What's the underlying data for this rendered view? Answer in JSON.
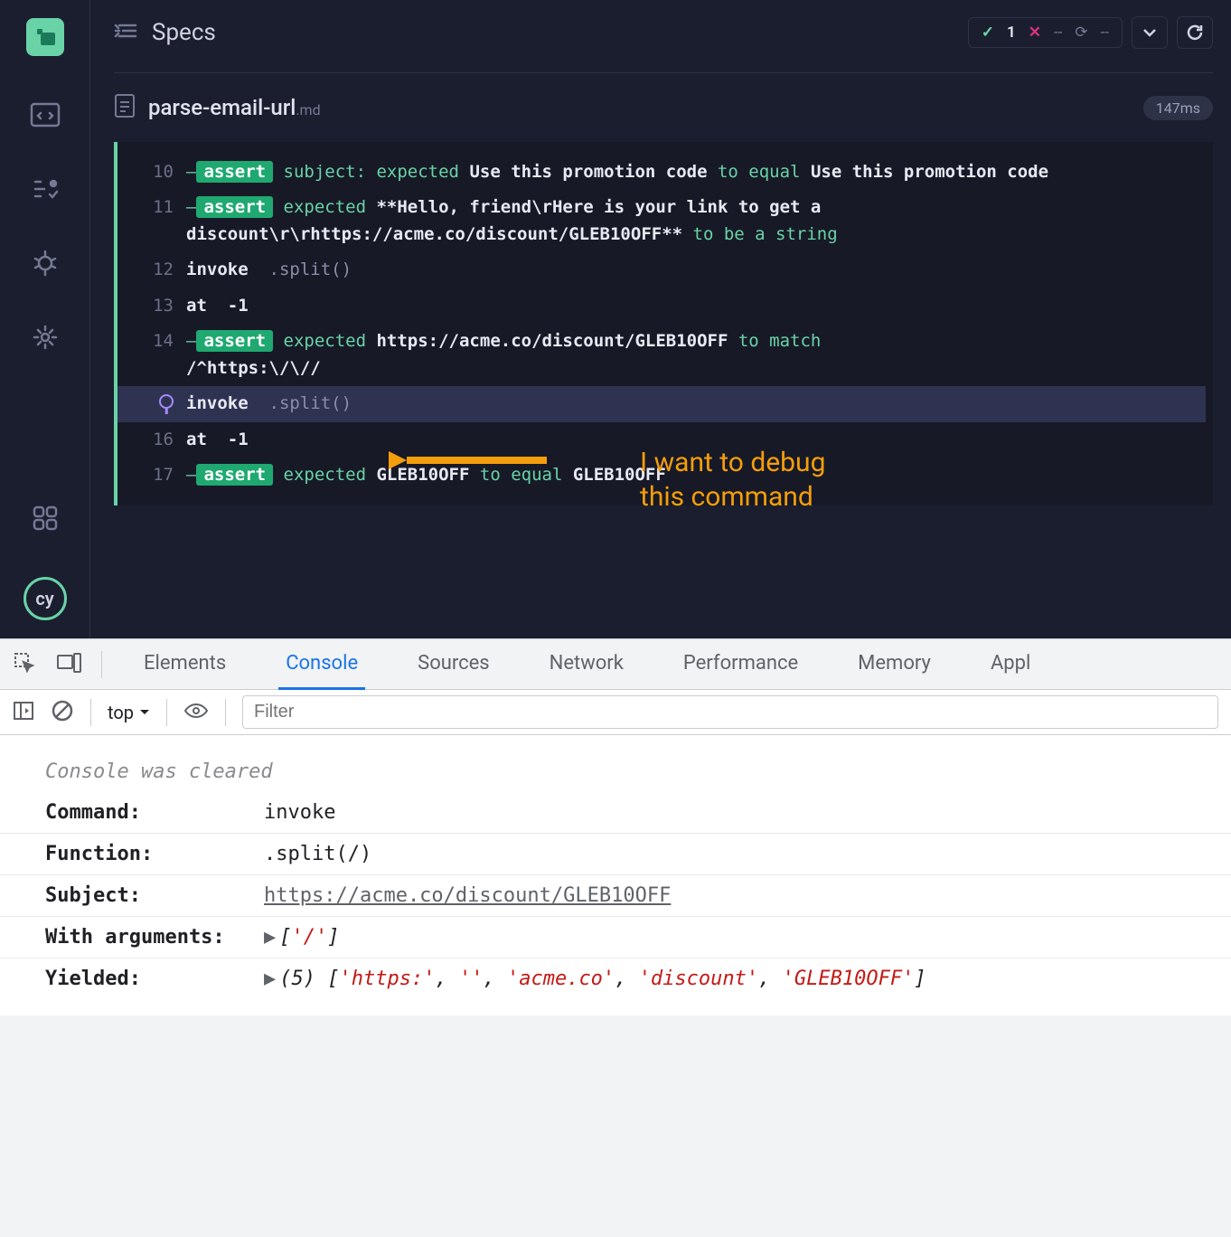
{
  "header": {
    "specs_label": "Specs",
    "pass_count": "1",
    "fail_count": "--",
    "pending_count": "--"
  },
  "file": {
    "name": "parse-email-url",
    "ext": ".md",
    "time": "147ms"
  },
  "log": [
    {
      "n": "10",
      "pre": "—",
      "badge": "assert",
      "a": " subject: expected ",
      "b": "Use this promotion code",
      "c": " to equal ",
      "d": "Use this promotion code"
    },
    {
      "n": "11",
      "pre": "—",
      "badge": "assert",
      "a": " expected ",
      "b": "**Hello, friend\\rHere is your link to get a discount\\r\\rhttps://acme.co/discount/GLEB10OFF**",
      "c": " to be a string"
    },
    {
      "n": "12",
      "cmd": "invoke",
      "arg": ".split()"
    },
    {
      "n": "13",
      "cmd": "at",
      "arg": "-1",
      "argClass": "white"
    },
    {
      "n": "14",
      "pre": "—",
      "badge": "assert",
      "a": " expected ",
      "b": "https://acme.co/discount/GLEB10OFF",
      "c": " to match ",
      "tail": "/^https:\\/\\//"
    },
    {
      "pinned": true,
      "cmd": "invoke",
      "arg": ".split()"
    },
    {
      "n": "16",
      "cmd": "at",
      "arg": "-1",
      "argClass": "white"
    },
    {
      "n": "17",
      "pre": "—",
      "badge": "assert",
      "a": " expected ",
      "b": "GLEB10OFF",
      "c": " to equal ",
      "d": "GLEB10OFF"
    }
  ],
  "annotation": {
    "line1": "I want to debug",
    "line2": "this command"
  },
  "devtools": {
    "tabs": [
      "Elements",
      "Console",
      "Sources",
      "Network",
      "Performance",
      "Memory",
      "Appl"
    ],
    "active_tab": "Console",
    "context": "top",
    "filter_placeholder": "Filter"
  },
  "console": {
    "cleared": "Console was cleared",
    "entries": [
      {
        "key": "Command:",
        "val": "invoke"
      },
      {
        "key": "Function:",
        "val": ".split(/)"
      },
      {
        "key": "Subject:",
        "type": "link",
        "val": "https://acme.co/discount/GLEB10OFF"
      },
      {
        "key": "With arguments:",
        "type": "array1",
        "val": "['/']"
      },
      {
        "key": "Yielded:",
        "type": "array5",
        "count": "(5)",
        "items": [
          "'https:'",
          "''",
          "'acme.co'",
          "'discount'",
          "'GLEB10OFF'"
        ]
      }
    ]
  }
}
